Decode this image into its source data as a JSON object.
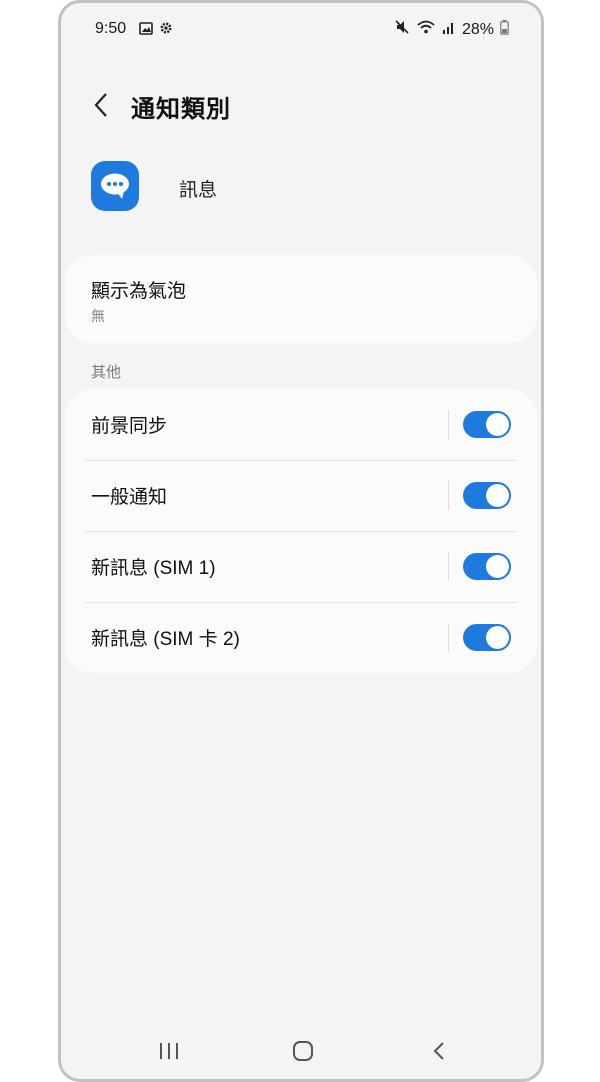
{
  "status_bar": {
    "time": "9:50",
    "battery": "28%",
    "left_icons": [
      "image-icon",
      "gear-icon"
    ],
    "right_icons": [
      "mute-icon",
      "wifi-icon",
      "signal-icon",
      "battery-icon"
    ]
  },
  "header": {
    "title": "通知類別",
    "back_icon": "back-arrow-icon"
  },
  "app": {
    "name": "訊息",
    "icon": "messages-app-icon",
    "color": "#1f7ae0"
  },
  "bubble_setting": {
    "title": "顯示為氣泡",
    "value": "無"
  },
  "section": {
    "label": "其他"
  },
  "categories": [
    {
      "label": "前景同步",
      "enabled": true
    },
    {
      "label": "一般通知",
      "enabled": true
    },
    {
      "label": "新訊息 (SIM 1)",
      "enabled": true
    },
    {
      "label": "新訊息 (SIM 卡 2)",
      "enabled": true
    }
  ],
  "nav_bar": {
    "icons": [
      "recents-icon",
      "home-icon",
      "back-icon"
    ]
  },
  "colors": {
    "accent": "#1f7ae0",
    "background": "#f4f4f4",
    "card": "#fbfbfb"
  }
}
